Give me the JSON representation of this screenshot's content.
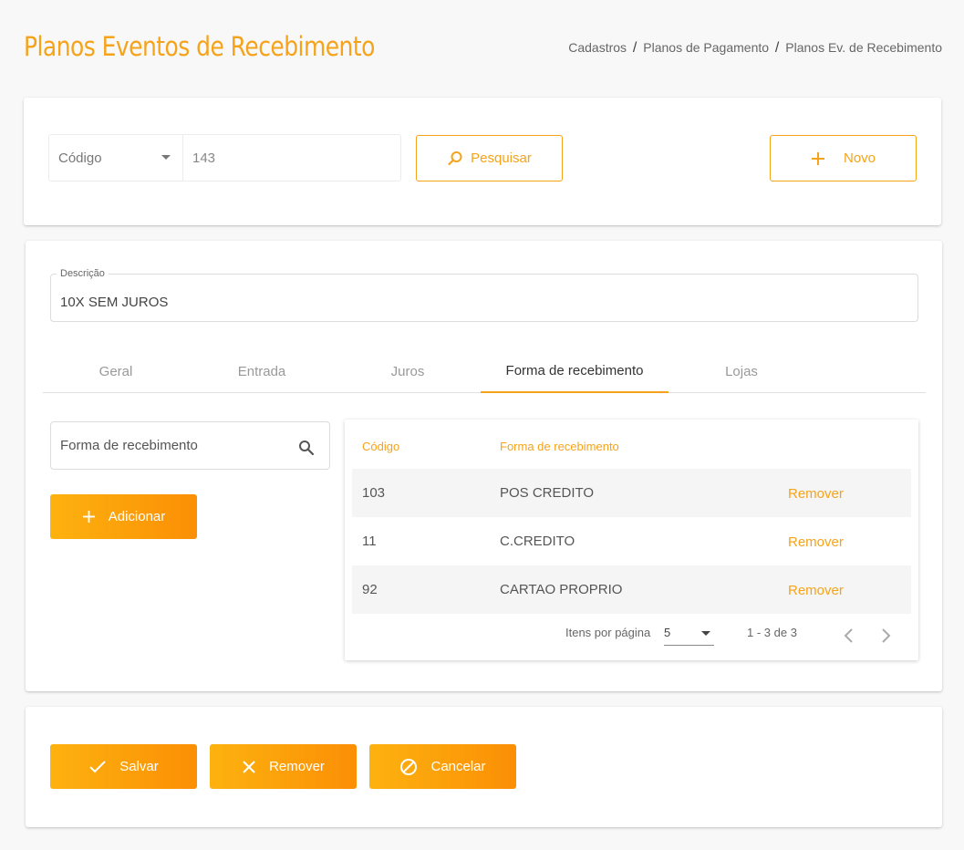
{
  "header": {
    "title": "Planos Eventos de Recebimento",
    "breadcrumb": [
      "Cadastros",
      "Planos de Pagamento",
      "Planos Ev. de Recebimento"
    ],
    "breadcrumb_sep": "/"
  },
  "search": {
    "field_select": "Código",
    "code_value": "143",
    "search_label": "Pesquisar",
    "new_label": "Novo"
  },
  "description": {
    "label": "Descrição",
    "value": "10X SEM JUROS"
  },
  "tabs": [
    {
      "label": "Geral",
      "active": false
    },
    {
      "label": "Entrada",
      "active": false
    },
    {
      "label": "Juros",
      "active": false
    },
    {
      "label": "Forma de recebimento",
      "active": true
    },
    {
      "label": "Lojas",
      "active": false
    }
  ],
  "payment_form": {
    "search_placeholder": "Forma de recebimento",
    "add_label": "Adicionar"
  },
  "table": {
    "columns": [
      "Código",
      "Forma de recebimento"
    ],
    "rows": [
      {
        "code": "103",
        "name": "POS CREDITO",
        "action": "Remover"
      },
      {
        "code": "11",
        "name": "C.CREDITO",
        "action": "Remover"
      },
      {
        "code": "92",
        "name": "CARTAO PROPRIO",
        "action": "Remover"
      }
    ],
    "items_per_page_label": "Itens por página",
    "items_per_page": "5",
    "range_label": "1 - 3 de 3"
  },
  "footer": {
    "save_label": "Salvar",
    "remove_label": "Remover",
    "cancel_label": "Cancelar"
  },
  "colors": {
    "accent": "#f5a31a",
    "button_gradient_start": "#fdb20f",
    "button_gradient_end": "#fb8f05"
  }
}
